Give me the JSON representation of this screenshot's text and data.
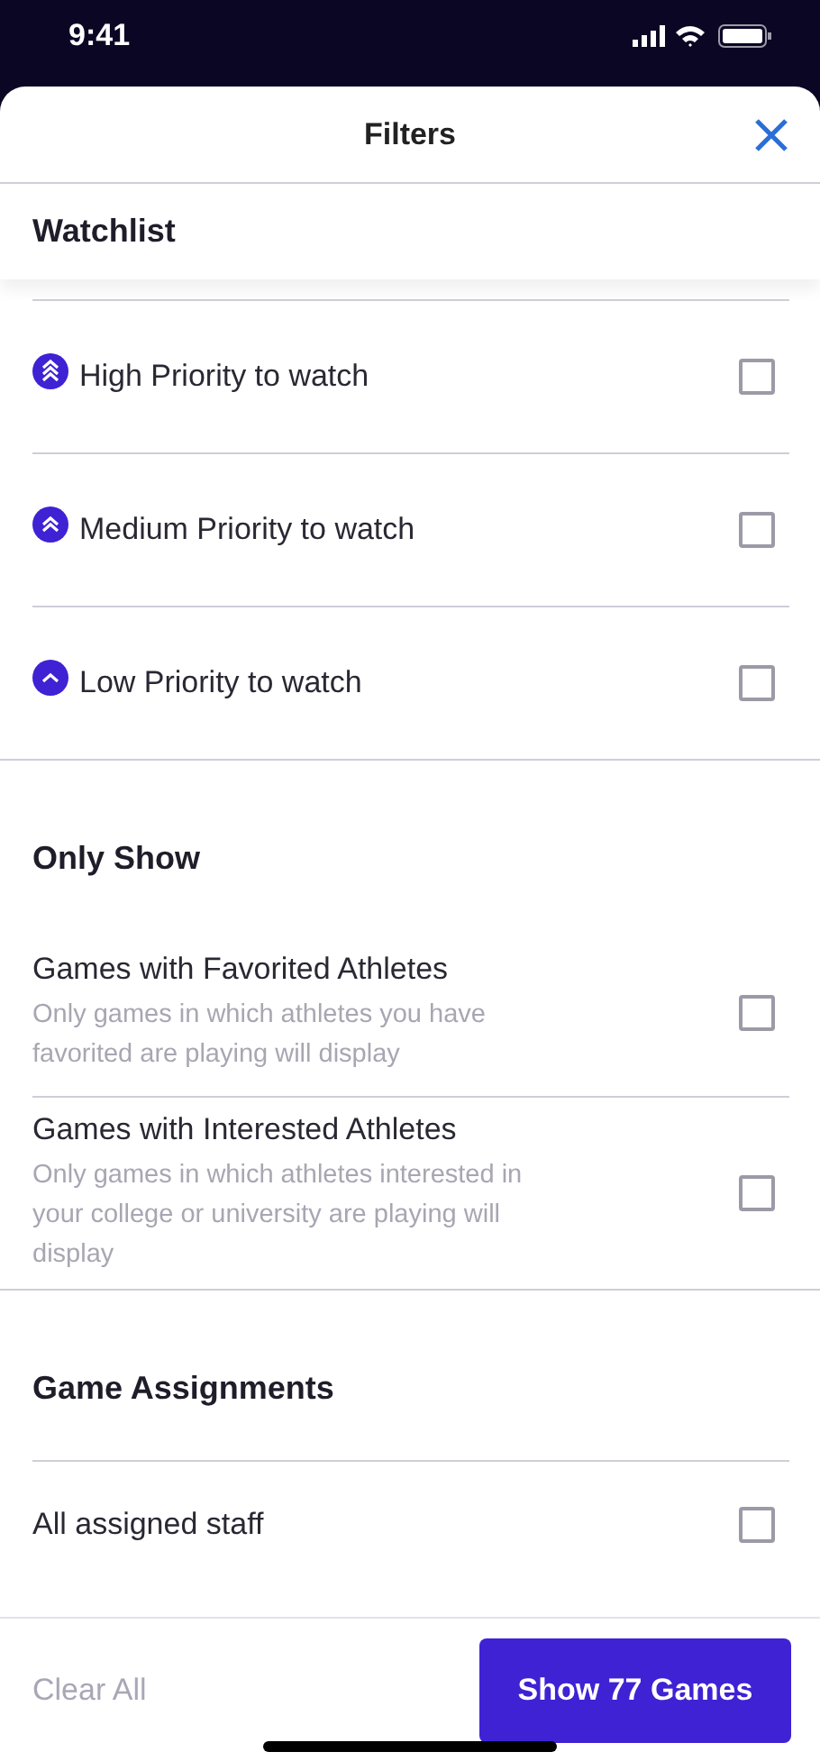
{
  "status_bar": {
    "time": "9:41"
  },
  "header": {
    "title": "Filters"
  },
  "sections": [
    {
      "title": "Watchlist",
      "sticky": true,
      "items": [
        {
          "label": "High Priority to watch",
          "kind": "high",
          "checked": false
        },
        {
          "label": "Medium Priority to watch",
          "kind": "medium",
          "checked": false
        },
        {
          "label": "Low Priority to watch",
          "kind": "low",
          "checked": false
        }
      ]
    },
    {
      "title": "Only Show",
      "sticky": false,
      "items": [
        {
          "label": "Games with Favorited Athletes",
          "description": "Only games in which athletes you have favorited are playing will display",
          "kind": "plain",
          "checked": false
        },
        {
          "label": "Games with Interested Athletes",
          "description": "Only games in which athletes interested in your college or university are playing will display",
          "kind": "plain",
          "checked": false
        }
      ]
    },
    {
      "title": "Game Assignments",
      "sticky": false,
      "items": [
        {
          "label": "All assigned staff",
          "kind": "plain",
          "checked": false
        }
      ]
    }
  ],
  "footer": {
    "clear": {
      "label": "Clear All",
      "disabled": true
    },
    "apply": {
      "label": "Show 77 Games"
    }
  }
}
